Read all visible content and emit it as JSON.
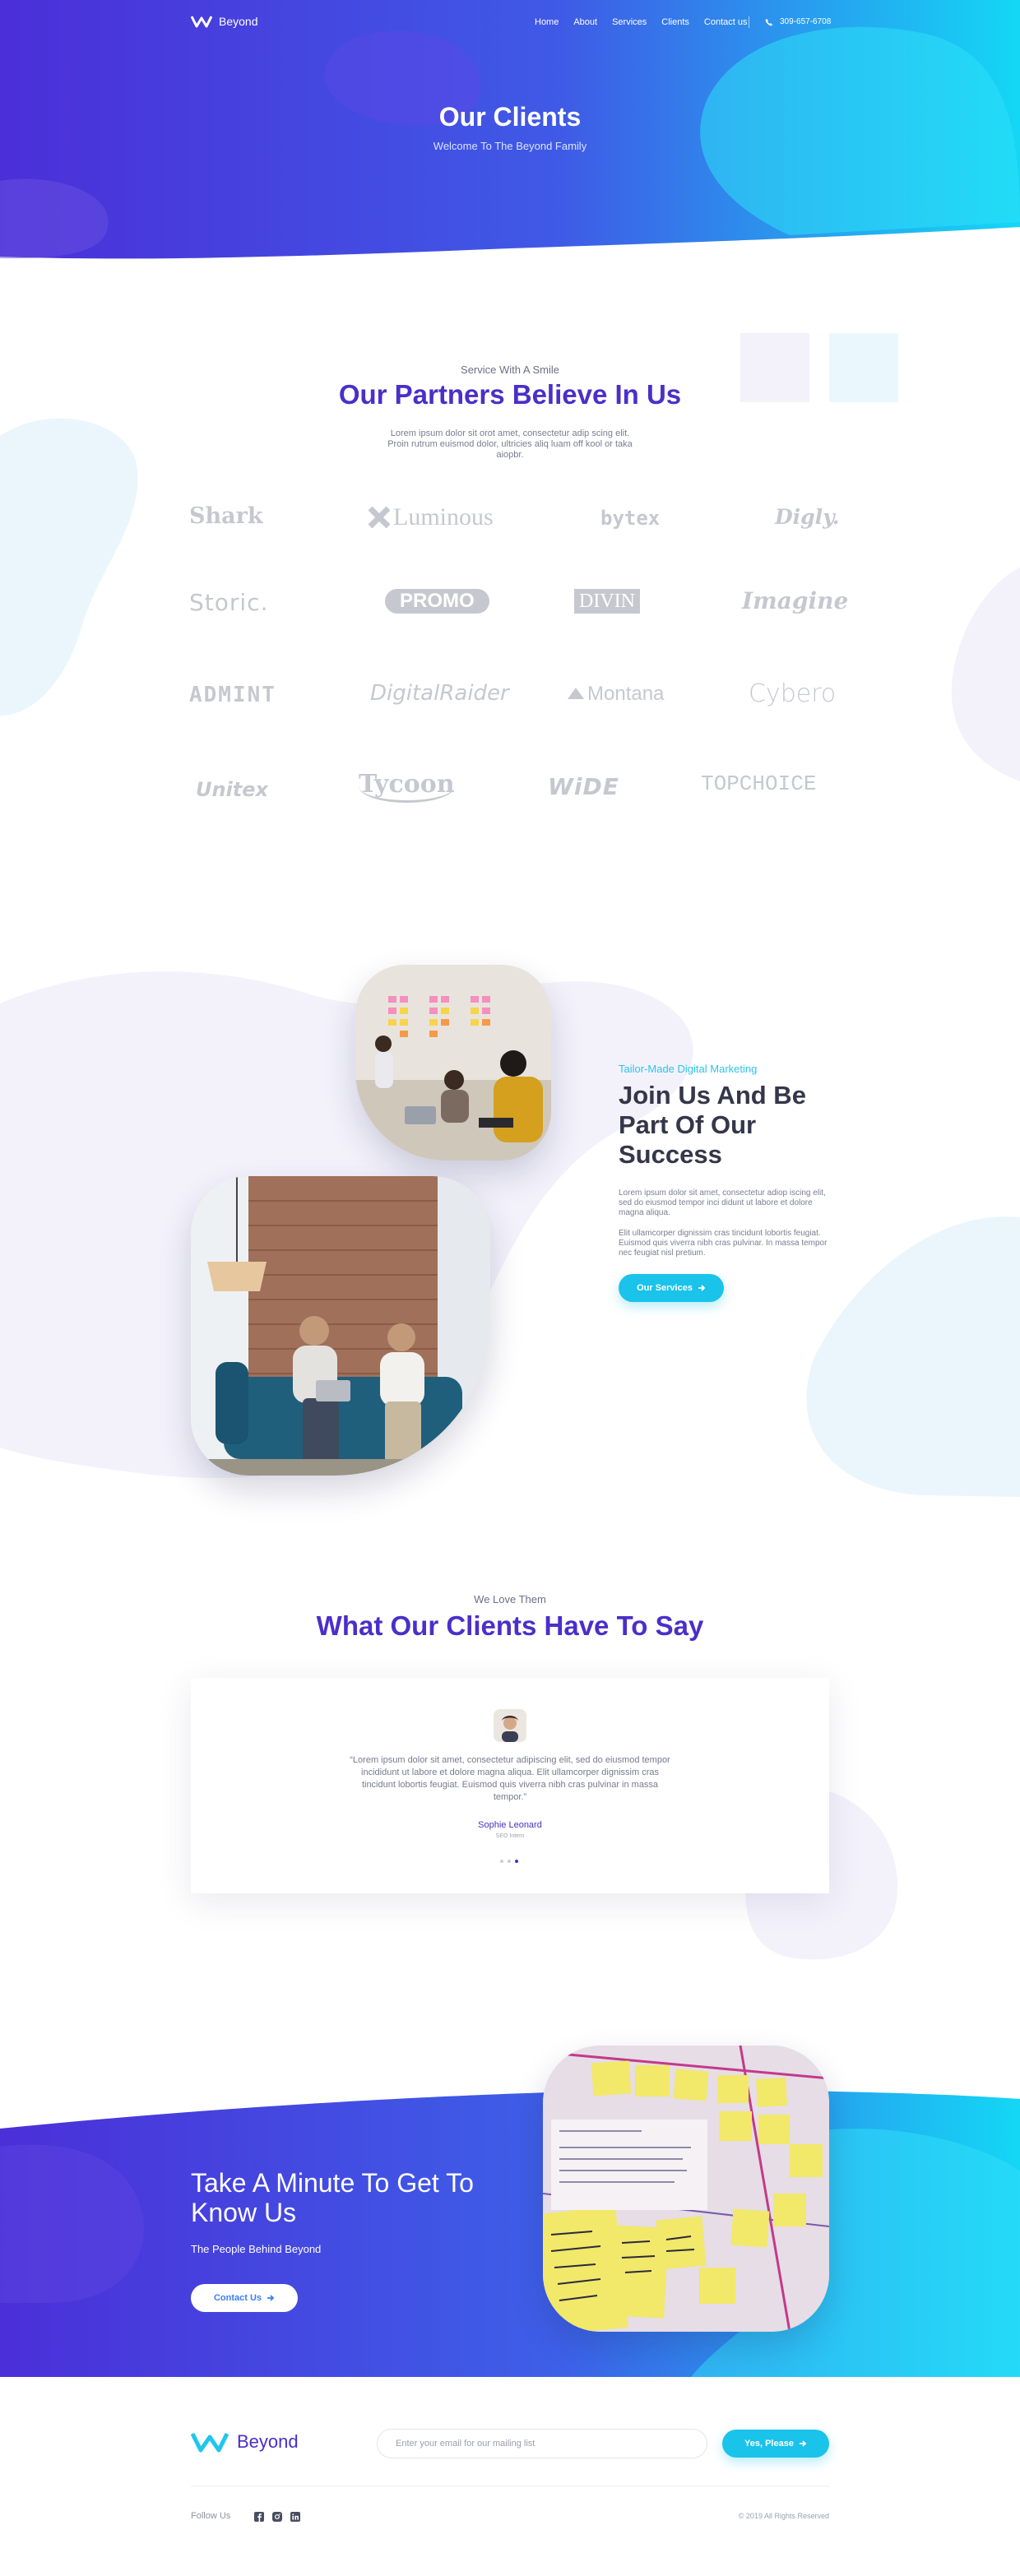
{
  "brand": {
    "name": "Beyond"
  },
  "nav": {
    "links": [
      "Home",
      "About",
      "Services",
      "Clients",
      "Contact us"
    ],
    "phone": "309-657-6708"
  },
  "hero": {
    "title": "Our Clients",
    "subtitle": "Welcome To The Beyond Family"
  },
  "partners": {
    "eyebrow": "Service With A Smile",
    "title": "Our Partners Believe In Us",
    "text": "Lorem ipsum dolor sit orot amet, consectetur adip scing elit. Proin rutrum euismod dolor, ultricies aliq luam off kool or taka aiopbr.",
    "logos": [
      "Shark",
      "Luminous",
      "bytex",
      "Digly.",
      "Storic.",
      "PROMO",
      "DIVIN",
      "Imagine",
      "ADMINT",
      "DigitalRaider",
      "Montana",
      "Cybero",
      "Unitex",
      "Tycoon",
      "WiDE",
      "TOPCHOICE"
    ]
  },
  "join": {
    "eyebrow": "Tailor-Made Digital Marketing",
    "title": "Join Us And Be Part Of Our Success",
    "p1": "Lorem ipsum dolor sit amet, consectetur adiop iscing elit, sed do eiusmod tempor inci didunt ut labore et dolore magna aliqua.",
    "p2": "Elit ullamcorper dignissim cras tincidunt lobortis feugiat. Euismod quis viverra nibh cras pulvinar. In massa tempor nec feugiat nisl pretium.",
    "button": "Our Services"
  },
  "testimonials": {
    "eyebrow": "We Love Them",
    "title": "What Our Clients Have To Say",
    "quote": "“Lorem ipsum dolor sit amet, consectetur adipiscing elit, sed do eiusmod tempor incididunt ut labore et dolore magna aliqua. Elit ullamcorper dignissim cras tincidunt lobortis feugiat. Euismod quis viverra nibh cras pulvinar in massa tempor.”",
    "name": "Sophie Leonard",
    "role": "SEO Intern",
    "active_dot": 2,
    "dot_count": 3
  },
  "cta": {
    "title": "Take A Minute To Get To Know Us",
    "subtitle": "The People Behind Beyond",
    "button": "Contact Us"
  },
  "footer": {
    "email_placeholder": "Enter your email for our mailing list",
    "subscribe": "Yes, Please",
    "follow": "Follow Us",
    "copyright": "© 2019 All Rights Reserved"
  },
  "colors": {
    "primary": "#4a2fc8",
    "accent": "#19c3ea",
    "gradient_start": "#4b2fd8",
    "gradient_end": "#14d7f5"
  }
}
